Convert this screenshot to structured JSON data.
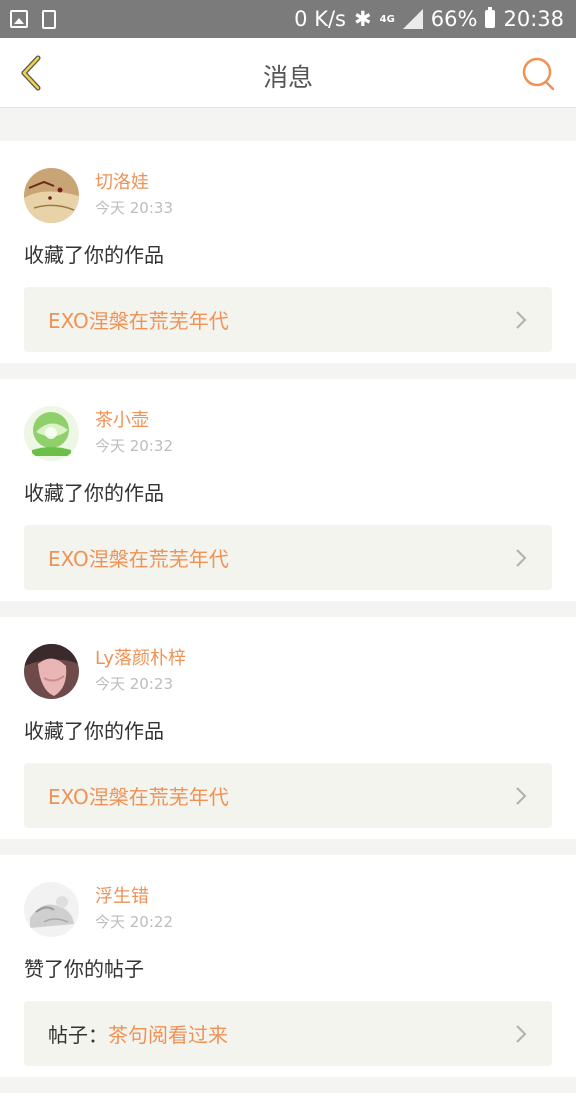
{
  "status_bar": {
    "speed": "0 K/s",
    "network": "4G",
    "battery": "66%",
    "time": "20:38"
  },
  "header": {
    "title": "消息"
  },
  "messages": [
    {
      "user": "切洛娃",
      "time": "今天 20:33",
      "action": "收藏了你的作品",
      "link_prefix": "",
      "link_title": "EXO涅槃在荒芜年代"
    },
    {
      "user": "茶小壶",
      "time": "今天 20:32",
      "action": "收藏了你的作品",
      "link_prefix": "",
      "link_title": "EXO涅槃在荒芜年代"
    },
    {
      "user": "Ly落颜朴梓",
      "time": "今天 20:23",
      "action": "收藏了你的作品",
      "link_prefix": "",
      "link_title": "EXO涅槃在荒芜年代"
    },
    {
      "user": "浮生错",
      "time": "今天 20:22",
      "action": "赞了你的帖子",
      "link_prefix": "帖子：",
      "link_title": "茶句阅看过来"
    }
  ],
  "colors": {
    "accent": "#ef9256",
    "status_bar": "#7b7b7b",
    "link_bg": "#f4f4ee"
  }
}
